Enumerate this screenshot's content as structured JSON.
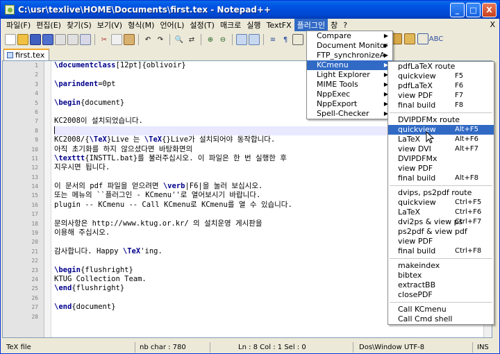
{
  "window": {
    "title": "C:\\usr\\texlive\\HOME\\Documents\\first.tex - Notepad++",
    "controls": {
      "minimize": "_",
      "maximize": "□",
      "close": "X"
    }
  },
  "menubar": {
    "items": [
      "파일(F)",
      "편집(E)",
      "찾기(S)",
      "보기(V)",
      "형식(M)",
      "언어(L)",
      "설정(T)",
      "매크로",
      "실행",
      "TextFX",
      "플러그인",
      "창",
      "?"
    ],
    "close_glyph": "X"
  },
  "tab": {
    "label": "first.tex"
  },
  "editor": {
    "line_numbers": [
      "1",
      "2",
      "3",
      "4",
      "5",
      "6",
      "7",
      "8",
      "9",
      "10",
      "11",
      "12",
      "13",
      "14",
      "15",
      "16",
      "17",
      "18",
      "19",
      "20",
      "21",
      "22",
      "23",
      "24",
      "25",
      "26",
      "27",
      "28"
    ],
    "lines": [
      "\\documentclass[12pt]{oblivoir}",
      "",
      "\\parindent=0pt",
      "",
      "\\begin{document}",
      "",
      "KC2008이 설치되었습니다.",
      "",
      "KC2008/{\\TeX}Live 는 \\TeX{}Live가 설치되어야 동작합니다.",
      "아직 초기화를 하지 않으셨다면 바탕화면의",
      "\\texttt{INSTTL.bat}를 불러주십시오. 이 파일은 한 번 실행한 후",
      "지우시면 됩니다.",
      "",
      "이 문서의 pdf 파일을 얻으려면 \\verb|F6|을 눌러 보십시오.",
      "또는 메뉴의 ``플러그인 - KCmenu''로 열어보시기 바랍니다.",
      "plugin -- KCmenu -- Call KCmenu로 KCmenu를 열 수 있습니다.",
      "",
      "문의사항은 http://www.ktug.or.kr/ 의 설치운영 게시판을",
      "이용해 주십시오.",
      "",
      "감사합니다. Happy \\TeX'ing.",
      "",
      "\\begin{flushright}",
      "KTUG Collection Team.",
      "\\end{flushright}",
      "",
      "\\end{document}",
      ""
    ]
  },
  "plugin_menu": {
    "items": [
      {
        "label": "Compare",
        "submenu": true
      },
      {
        "label": "Document Monitor",
        "submenu": true
      },
      {
        "label": "FTP_synchronizeA",
        "submenu": true
      },
      {
        "label": "KCmenu",
        "submenu": true,
        "highlighted": true
      },
      {
        "label": "Light Explorer",
        "submenu": true
      },
      {
        "label": "MIME Tools",
        "submenu": true
      },
      {
        "label": "NppExec",
        "submenu": true
      },
      {
        "label": "NppExport",
        "submenu": true
      },
      {
        "label": "Spell-Checker",
        "submenu": true
      }
    ]
  },
  "kcmenu": {
    "groups": [
      [
        {
          "label": "pdfLaTeX route",
          "shortcut": ""
        },
        {
          "label": "quickview",
          "shortcut": "F5"
        },
        {
          "label": "pdfLaTeX",
          "shortcut": "F6"
        },
        {
          "label": "view PDF",
          "shortcut": "F7"
        },
        {
          "label": "final build",
          "shortcut": "F8"
        }
      ],
      [
        {
          "label": "DVIPDFMx route",
          "shortcut": ""
        },
        {
          "label": "quickview",
          "shortcut": "Alt+F5",
          "highlighted": true
        },
        {
          "label": "LaTeX",
          "shortcut": "Alt+F6"
        },
        {
          "label": "view DVI",
          "shortcut": "Alt+F7"
        },
        {
          "label": "DVIPDFMx",
          "shortcut": ""
        },
        {
          "label": "view PDF",
          "shortcut": ""
        },
        {
          "label": "final build",
          "shortcut": "Alt+F8"
        }
      ],
      [
        {
          "label": "dvips, ps2pdf route",
          "shortcut": ""
        },
        {
          "label": "quickview",
          "shortcut": "Ctrl+F5"
        },
        {
          "label": "LaTeX",
          "shortcut": "Ctrl+F6"
        },
        {
          "label": "dvi2ps & view ps",
          "shortcut": "Ctrl+F7"
        },
        {
          "label": "ps2pdf & view pdf",
          "shortcut": ""
        },
        {
          "label": "view PDF",
          "shortcut": ""
        },
        {
          "label": "final build",
          "shortcut": "Ctrl+F8"
        }
      ],
      [
        {
          "label": "makeindex",
          "shortcut": ""
        },
        {
          "label": "bibtex",
          "shortcut": ""
        },
        {
          "label": "extractBB",
          "shortcut": ""
        },
        {
          "label": "closePDF",
          "shortcut": ""
        }
      ],
      [
        {
          "label": "Call KCmenu",
          "shortcut": ""
        },
        {
          "label": "Call Cmd shell",
          "shortcut": ""
        }
      ]
    ]
  },
  "statusbar": {
    "filetype": "TeX file",
    "nb_char": "nb char : 780",
    "position": "Ln : 8    Col : 1    Sel : 0",
    "encoding": "Dos\\Window   UTF-8",
    "mode": "INS"
  }
}
